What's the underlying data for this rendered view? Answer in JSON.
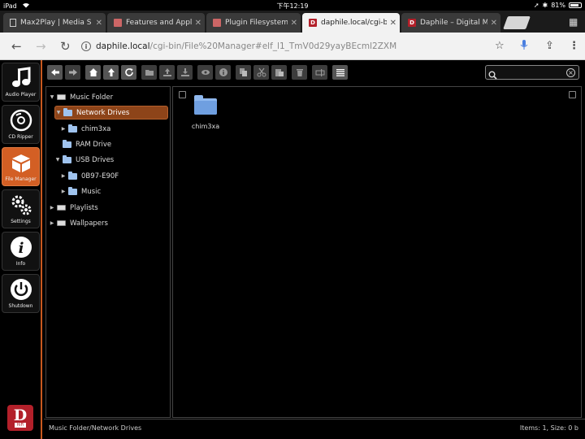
{
  "status_bar": {
    "device": "iPad",
    "time": "下午12:19",
    "battery": "81%"
  },
  "browser": {
    "tabs": [
      {
        "label": "Max2Play | Media S",
        "favicon": "document-icon",
        "active": false
      },
      {
        "label": "Features and Applic",
        "favicon": "cube-icon",
        "active": false
      },
      {
        "label": "Plugin Filesystem/",
        "favicon": "cube-icon",
        "active": false
      },
      {
        "label": "daphile.local/cgi-bi",
        "favicon": "daphile-icon",
        "active": true
      },
      {
        "label": "Daphile – Digital Mu",
        "favicon": "daphile-icon",
        "active": false
      }
    ],
    "url_host": "daphile.local",
    "url_path": "/cgi-bin/File%20Manager#elf_l1_TmV0d29yayBEcml2ZXM"
  },
  "app_nav": [
    {
      "label": "Audio Player",
      "icon": "music-note-icon"
    },
    {
      "label": "CD Ripper",
      "icon": "cd-icon"
    },
    {
      "label": "File Manager",
      "icon": "box-icon"
    },
    {
      "label": "Settings",
      "icon": "gears-icon"
    },
    {
      "label": "Info",
      "icon": "info-icon"
    },
    {
      "label": "Shutdown",
      "icon": "power-icon"
    }
  ],
  "logo": {
    "letter": "D",
    "sub": "HiFi"
  },
  "tree": {
    "music_folder": "Music Folder",
    "network_drives": "Network Drives",
    "chim3xa": "chim3xa",
    "ram_drive": "RAM Drive",
    "usb_drives": "USB Drives",
    "usb_0b97": "0B97-E90F",
    "music": "Music",
    "playlists": "Playlists",
    "wallpapers": "Wallpapers"
  },
  "files": [
    {
      "name": "chim3xa",
      "type": "folder"
    }
  ],
  "footer": {
    "path": "Music Folder/Network Drives",
    "summary": "Items: 1, Size: 0 b"
  },
  "colors": {
    "accent": "#d35f24",
    "selection": "#8d4419",
    "folder": "#8fb8ee"
  }
}
